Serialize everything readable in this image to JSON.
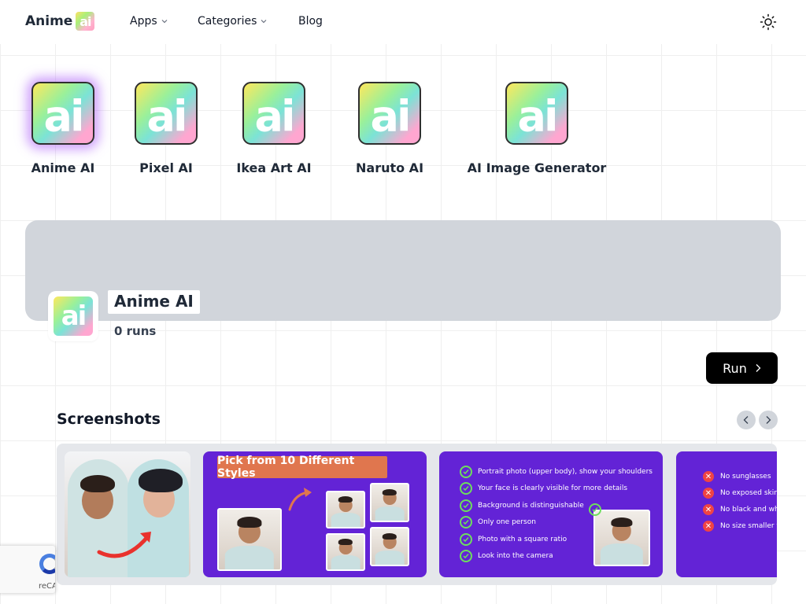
{
  "nav": {
    "brand": "Anime",
    "brand_badge": "ai",
    "items": [
      {
        "label": "Apps",
        "has_dropdown": true
      },
      {
        "label": "Categories",
        "has_dropdown": true
      },
      {
        "label": "Blog",
        "has_dropdown": false
      }
    ],
    "theme_icon": "sun-icon"
  },
  "apps": [
    {
      "name": "Anime AI",
      "logo_text": "ai",
      "selected": true
    },
    {
      "name": "Pixel AI",
      "logo_text": "ai",
      "selected": false
    },
    {
      "name": "Ikea Art AI",
      "logo_text": "ai",
      "selected": false
    },
    {
      "name": "Naruto AI",
      "logo_text": "ai",
      "selected": false
    },
    {
      "name": "AI Image Generator",
      "logo_text": "ai",
      "selected": false
    }
  ],
  "profile": {
    "logo_text": "ai",
    "title": "Anime AI",
    "runs": "0 runs",
    "run_button": "Run"
  },
  "screenshots": {
    "title": "Screenshots",
    "prev_icon": "chevron-left-icon",
    "next_icon": "chevron-right-icon",
    "styles_headline": "Pick from 10 Different Styles",
    "requirements": [
      "Portrait photo (upper body), show your shoulders",
      "Your face is clearly visible for more details",
      "Background is distinguishable",
      "Only one person",
      "Photo with a square ratio",
      "Look into the camera"
    ],
    "restrictions": [
      "No sunglasses",
      "No exposed skin",
      "No black and whi",
      "No size smaller t"
    ]
  },
  "recaptcha": {
    "label": "reCA"
  },
  "colors": {
    "accent_purple": "#6323d6",
    "button_black": "#000000",
    "banner_gray": "#d1d5db",
    "check_green": "#6ddf5c",
    "x_red": "#ef4444",
    "headline_orange": "#e0764e"
  }
}
